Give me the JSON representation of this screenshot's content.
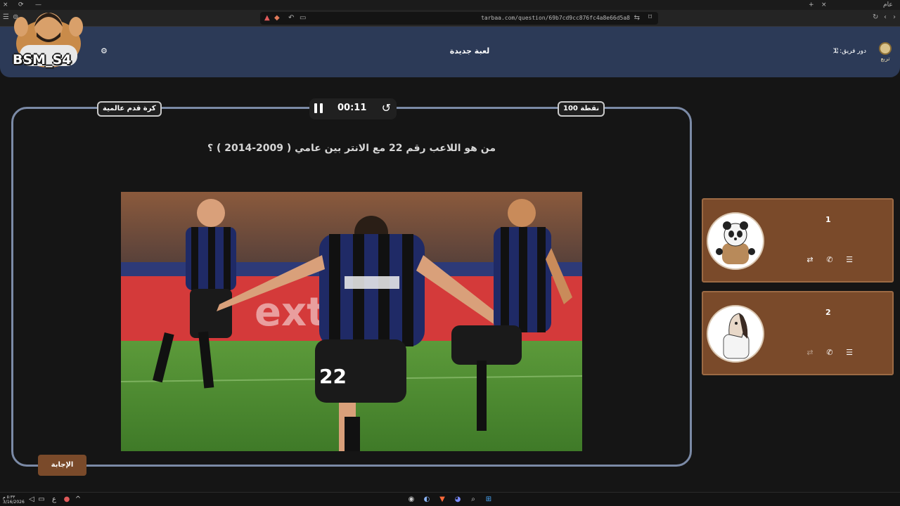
{
  "browser": {
    "url": "tarbaa.com/question/69b7cd9cc876fc4a8e66d5a8",
    "window_controls": {
      "close": "×",
      "reload": "⟳",
      "minimize": "—",
      "new_tab": "+",
      "close_tab": "×",
      "profile": "عام"
    }
  },
  "overlay": {
    "text": "BSM_S4"
  },
  "header": {
    "title": "لعبة جديدة",
    "turn_label": "دور فريق: 1",
    "brand": "تربع",
    "icons": {
      "settings": "settings-icon",
      "shuffle": "shuffle-icon"
    }
  },
  "question": {
    "category": "كرة قدم عالمية",
    "points": "100 نقطة",
    "timer": "00:11",
    "text": "من هو اللاعب رقم 22 مع الانتر بين عامي ( 2009-2014 ) ؟",
    "answer_button": "الإجابة"
  },
  "teams": [
    {
      "score": "1",
      "avatar": "panda-avatar-icon",
      "tools": [
        "swap-icon",
        "phone-icon",
        "list-icon"
      ]
    },
    {
      "score": "2",
      "avatar": "horse-avatar-icon",
      "tools": [
        "swap-icon",
        "phone-icon",
        "list-icon"
      ]
    }
  ],
  "taskbar": {
    "date": "3/16/2026",
    "time": "٥:٣٣ م",
    "language": "ع"
  },
  "colors": {
    "header": "#2c3a57",
    "team_card": "#7a4a2a",
    "frame_border": "#7b8aa6",
    "background": "#151515"
  }
}
